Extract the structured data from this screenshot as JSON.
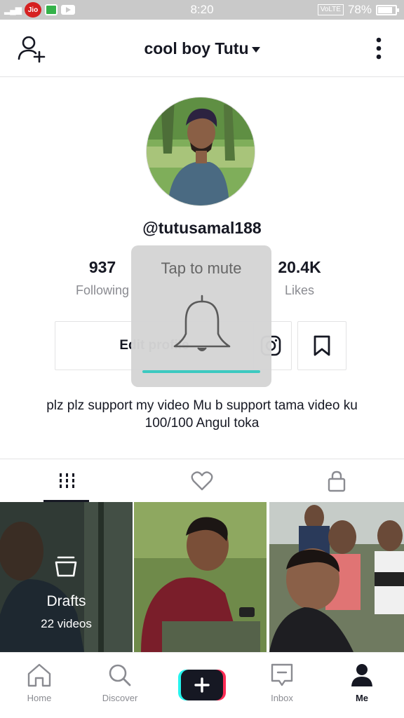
{
  "status_bar": {
    "carrier": "Jio",
    "time": "8:20",
    "network": "VoLTE",
    "battery": "78%"
  },
  "header": {
    "title": "cool boy Tutu"
  },
  "profile": {
    "username": "@tutusamal188",
    "stats": {
      "following_count": "937",
      "following_label": "Following",
      "likes_count": "20.4K",
      "likes_label": "Likes"
    },
    "edit_button_label": "Edit profile",
    "bio": "plz plz support my video Mu b support tama video ku 100/100 Angul toka"
  },
  "tabs": [
    "videos-grid",
    "liked",
    "private"
  ],
  "grid": {
    "drafts_title": "Drafts",
    "drafts_count": "22 videos"
  },
  "bottom_nav": {
    "home": "Home",
    "discover": "Discover",
    "inbox": "Inbox",
    "me": "Me"
  },
  "toast": {
    "text": "Tap to mute",
    "progress": 1.0
  },
  "colors": {
    "text": "#161823",
    "muted": "#8a8b91",
    "accent_cyan": "#25f4ee",
    "accent_red": "#fe2c55",
    "toast_bar": "#3cc9c0"
  }
}
